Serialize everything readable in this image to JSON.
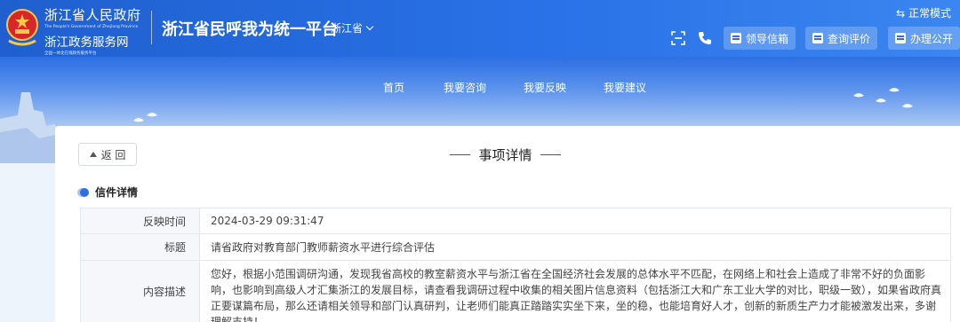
{
  "header": {
    "org_cn": "浙江省人民政府",
    "org_en": "The People's Government of Zhejiang Province",
    "service_cn": "浙江政务服务网",
    "service_slogan": "全国一体化在线政务服务平台",
    "platform_title": "浙江省民呼我为统一平台",
    "region": "浙江省",
    "mode_label": "正常模式",
    "buttons": [
      {
        "label": "领导信箱"
      },
      {
        "label": "查询评价"
      },
      {
        "label": "办理公开"
      }
    ],
    "colors": {
      "primary": "#2a73e8",
      "accent": "#2f6fe0"
    }
  },
  "nav": {
    "items": [
      "首页",
      "我要咨询",
      "我要反映",
      "我要建议"
    ]
  },
  "detail": {
    "back_label": "返 回",
    "section_title": "事项详情",
    "sub_title": "信件详情",
    "rows": [
      {
        "label": "反映时间",
        "value": "2024-03-29 09:31:47"
      },
      {
        "label": "标题",
        "value": "请省政府对教育部门教师薪资水平进行综合评估"
      },
      {
        "label": "内容描述",
        "value": "您好，根据小范围调研沟通，发现我省高校的教室薪资水平与浙江省在全国经济社会发展的总体水平不匹配，在网络上和社会上造成了非常不好的负面影响，也影响到高级人才汇集浙江的发展目标，请查看我调研过程中收集的相关图片信息资料（包括浙江大和广东工业大学的对比，职级一致），如果省政府真正要谋篇布局，那么还请相关领导和部门认真研判，让老师们能真正踏踏实实坐下来，坐的稳，也能培育好人才，创新的新质生产力才能被激发出来，多谢理解支持！"
      }
    ]
  }
}
